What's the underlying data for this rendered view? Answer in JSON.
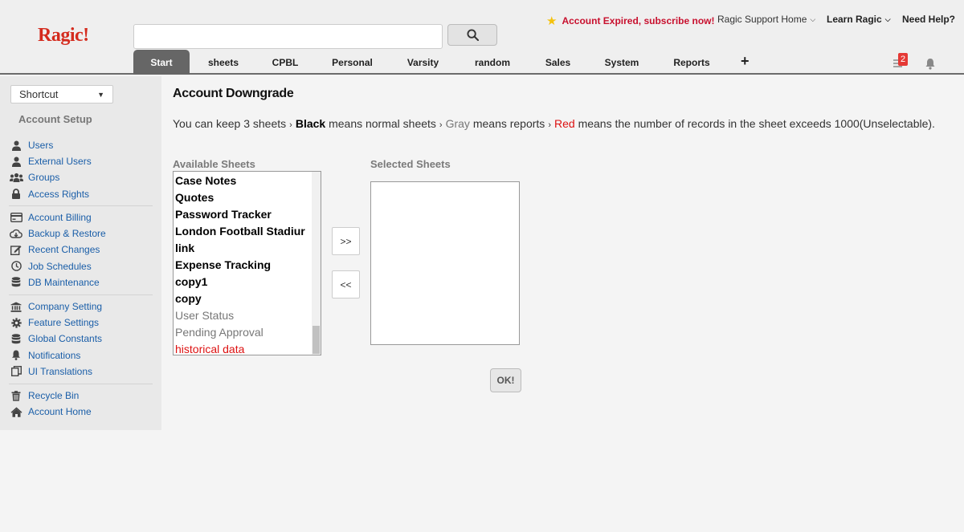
{
  "header": {
    "logo": "Ragic!",
    "search_placeholder": "",
    "expired_text": "Account Expired, subscribe now!",
    "support_label": "Ragic Support Home",
    "learn_label": "Learn Ragic",
    "help_label": "Need Help?",
    "notification_count": "2",
    "tabs": [
      {
        "label": "Start",
        "active": true
      },
      {
        "label": "sheets"
      },
      {
        "label": "CPBL"
      },
      {
        "label": "Personal"
      },
      {
        "label": "Varsity"
      },
      {
        "label": "random"
      },
      {
        "label": "Sales"
      },
      {
        "label": "System"
      },
      {
        "label": "Reports"
      }
    ],
    "add_tab": "+"
  },
  "sidebar": {
    "shortcut_label": "Shortcut",
    "section_title": "Account Setup",
    "groups": [
      [
        {
          "label": "Users",
          "icon": "user-icon"
        },
        {
          "label": "External Users",
          "icon": "external-user-icon"
        },
        {
          "label": "Groups",
          "icon": "groups-icon"
        },
        {
          "label": "Access Rights",
          "icon": "lock-icon"
        }
      ],
      [
        {
          "label": "Account Billing",
          "icon": "credit-card-icon"
        },
        {
          "label": "Backup & Restore",
          "icon": "cloud-download-icon"
        },
        {
          "label": "Recent Changes",
          "icon": "edit-icon"
        },
        {
          "label": "Job Schedules",
          "icon": "clock-icon"
        },
        {
          "label": "DB Maintenance",
          "icon": "database-icon"
        }
      ],
      [
        {
          "label": "Company Setting",
          "icon": "bank-icon"
        },
        {
          "label": "Feature Settings",
          "icon": "gear-icon"
        },
        {
          "label": "Global Constants",
          "icon": "database-icon"
        },
        {
          "label": "Notifications",
          "icon": "bell-icon"
        },
        {
          "label": "UI Translations",
          "icon": "copy-icon"
        }
      ],
      [
        {
          "label": "Recycle Bin",
          "icon": "trash-icon"
        },
        {
          "label": "Account Home",
          "icon": "home-icon"
        }
      ]
    ]
  },
  "main": {
    "title": "Account Downgrade",
    "desc_prefix": "You can keep 3 sheets",
    "desc_black": "Black",
    "desc_black_rest": "means normal sheets",
    "desc_gray": "Gray",
    "desc_gray_rest": "means reports",
    "desc_red": "Red",
    "desc_red_rest": "means the number of records in the sheet exceeds 1000(Unselectable).",
    "available_label": "Available Sheets",
    "selected_label": "Selected Sheets",
    "available_sheets": [
      {
        "label": "Case Notes",
        "kind": "normal"
      },
      {
        "label": "Quotes",
        "kind": "normal"
      },
      {
        "label": "Password Tracker",
        "kind": "normal"
      },
      {
        "label": "London Football Stadiur",
        "kind": "normal"
      },
      {
        "label": "link",
        "kind": "normal"
      },
      {
        "label": "Expense Tracking",
        "kind": "normal"
      },
      {
        "label": "copy1",
        "kind": "normal"
      },
      {
        "label": "copy",
        "kind": "normal"
      },
      {
        "label": "User Status",
        "kind": "report"
      },
      {
        "label": "Pending Approval",
        "kind": "report"
      },
      {
        "label": "historical data",
        "kind": "red"
      }
    ],
    "move_right_label": ">>",
    "move_left_label": "<<",
    "ok_label": "OK!"
  }
}
